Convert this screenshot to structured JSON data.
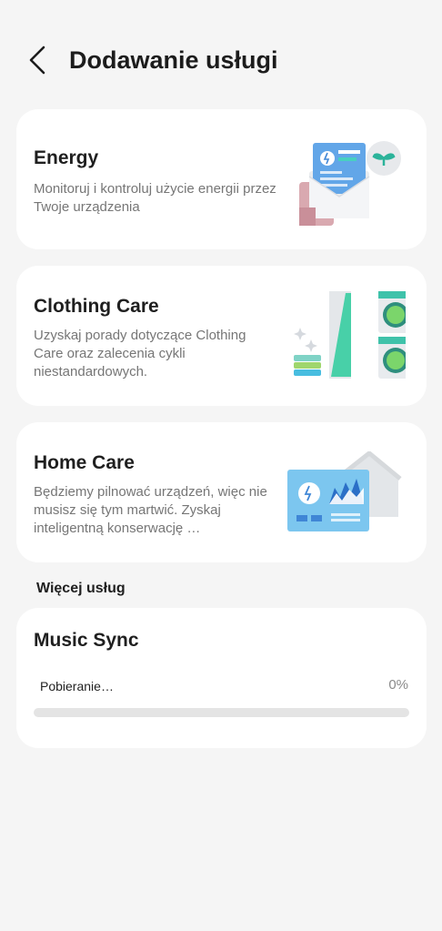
{
  "header": {
    "title": "Dodawanie usługi",
    "back_icon": "arrow-back-icon"
  },
  "services": [
    {
      "title": "Energy",
      "description": "Monitoruj i kontroluj użycie energii przez Twoje urządzenia",
      "illustration": "energy-report-illustration"
    },
    {
      "title": "Clothing Care",
      "description": "Uzyskaj porady dotyczące Clothing Care oraz zalecenia cykli niestandardowych.",
      "illustration": "washer-dryer-illustration"
    },
    {
      "title": "Home Care",
      "description": "Będziemy pilnować urządzeń, więc nie musisz się tym martwić. Zyskaj inteligentną konserwację …",
      "illustration": "home-care-dashboard-illustration"
    }
  ],
  "more": {
    "section_label": "Więcej usług",
    "music_sync": {
      "title": "Music Sync",
      "status": "Pobieranie…",
      "percent_label": "0%",
      "progress": 0
    }
  },
  "colors": {
    "background": "#f5f5f5",
    "card": "#ffffff",
    "accent_teal": "#3ec6b0",
    "accent_blue": "#5aa8e6"
  }
}
